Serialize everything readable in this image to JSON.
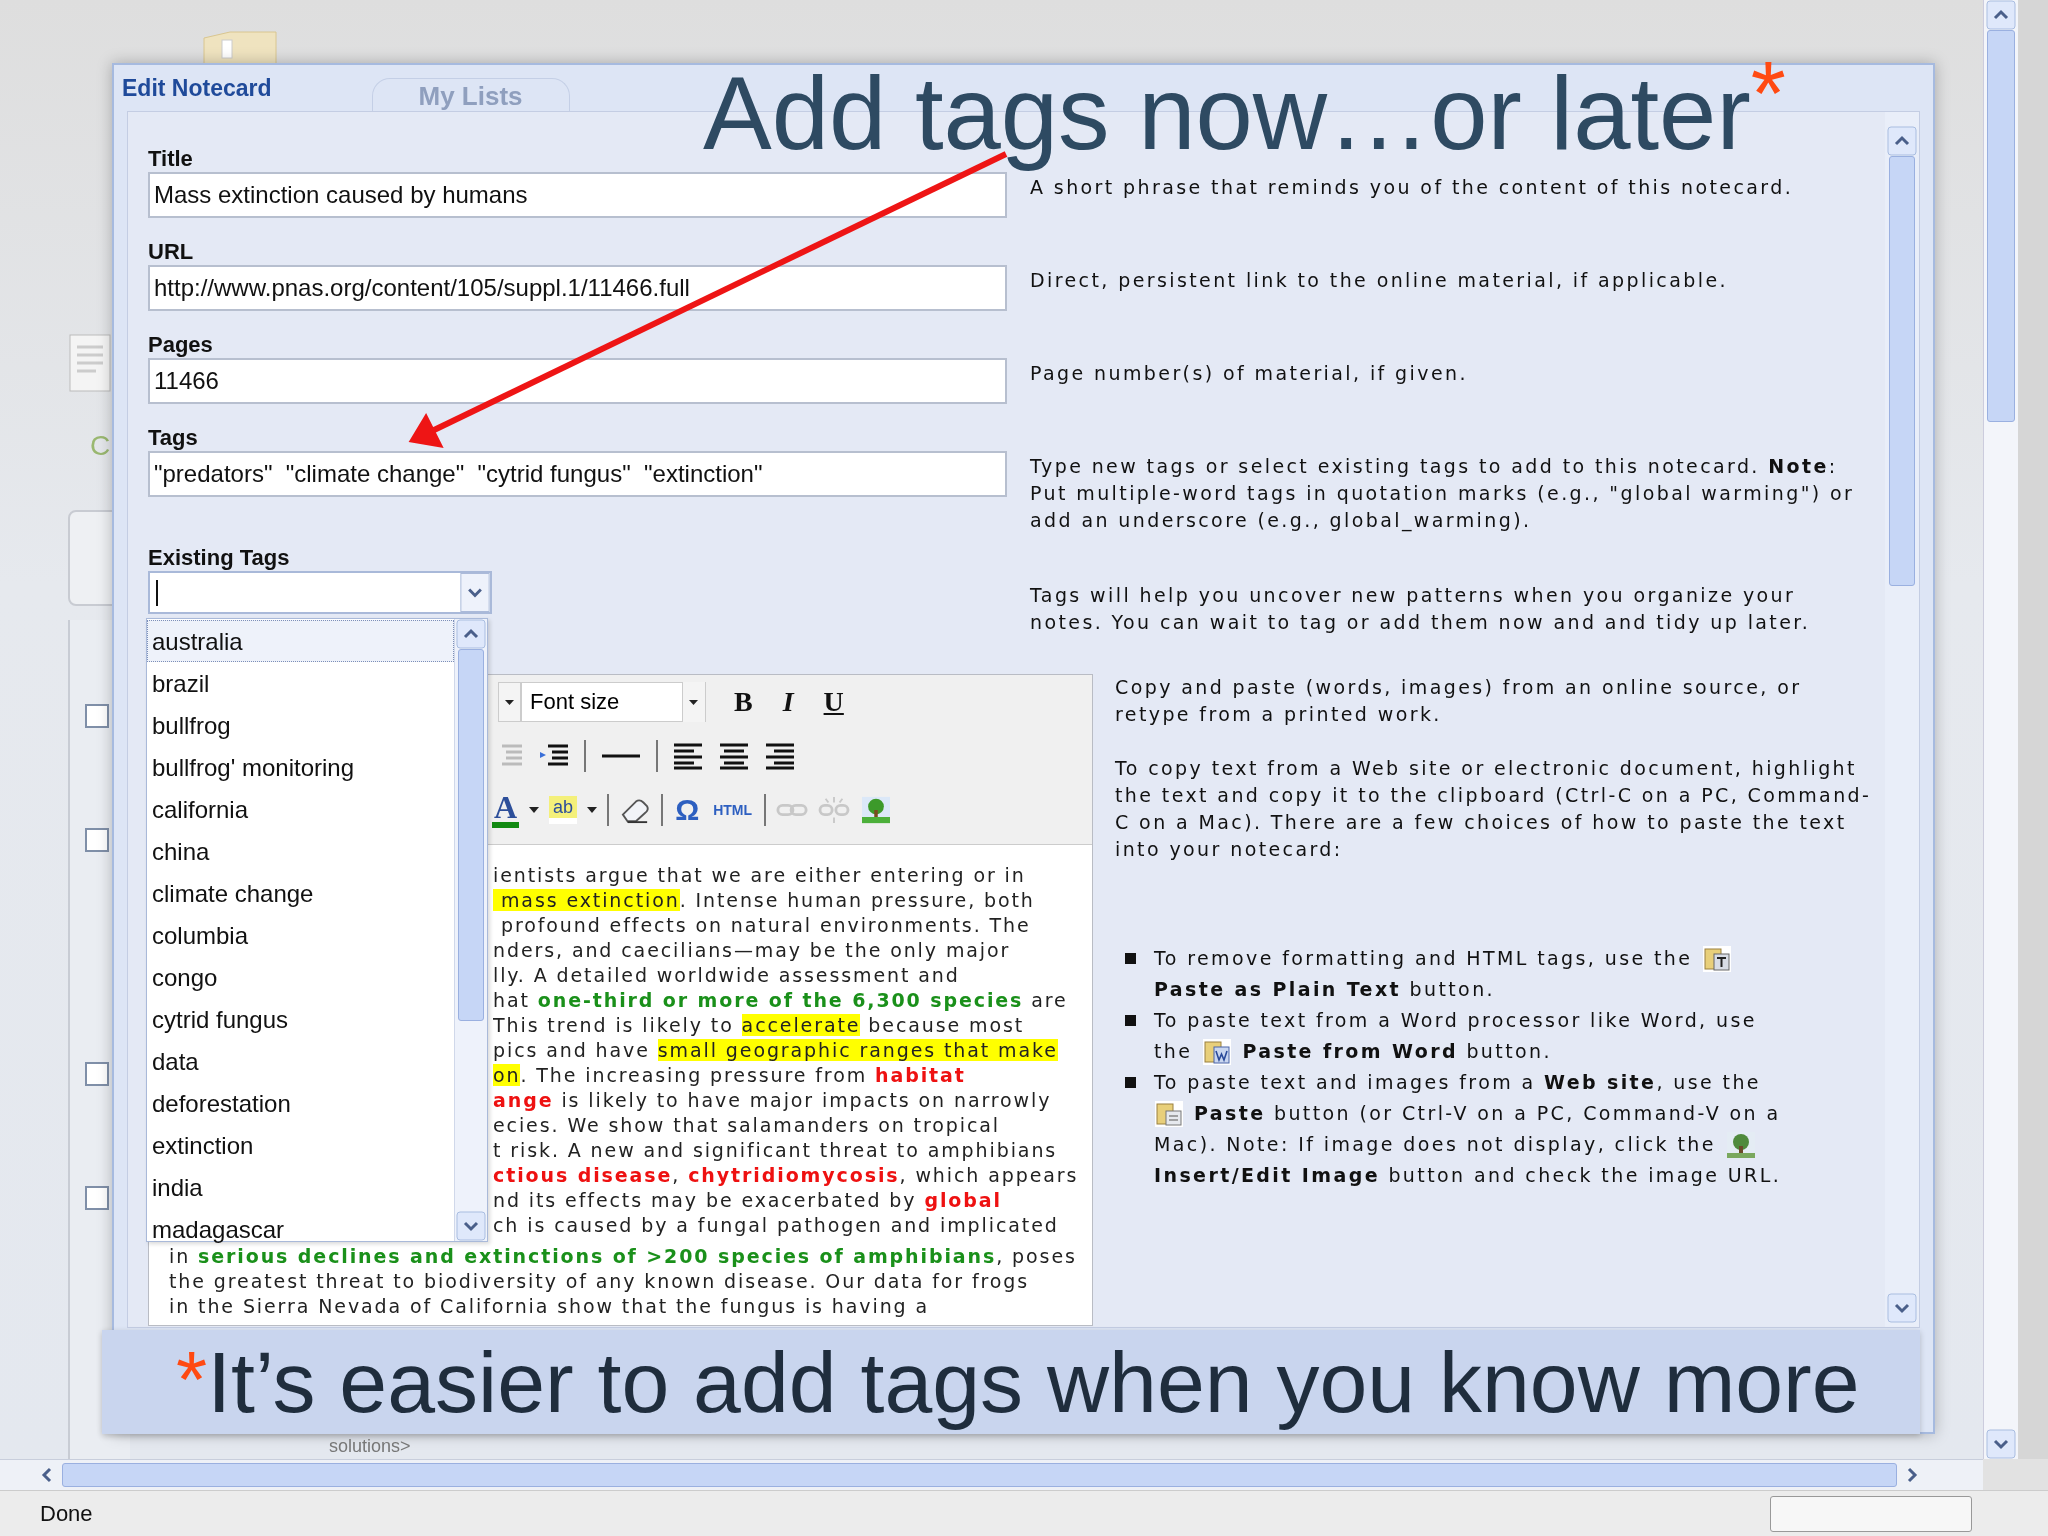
{
  "browser": {
    "status": "Done",
    "background": {
      "letter": "C",
      "footer_text": "solutions>",
      "checkboxes": [
        {
          "checked": false
        },
        {
          "checked": false
        },
        {
          "checked": false
        },
        {
          "checked": false
        }
      ]
    }
  },
  "annotation": {
    "text": "Add tags now…or later",
    "mark": "*"
  },
  "dialog": {
    "title": "Edit Notecard",
    "ghost_tab": "My Lists",
    "fields": [
      {
        "label": "Title",
        "value": "Mass extinction caused by humans",
        "help": "A short phrase that reminds you of the content of this notecard."
      },
      {
        "label": "URL",
        "value": "http://www.pnas.org/content/105/suppl.1/11466.full",
        "help": "Direct, persistent link to the online material, if applicable."
      },
      {
        "label": "Pages",
        "value": "11466",
        "help": "Page number(s) of material, if given."
      },
      {
        "label": "Tags",
        "value": "\"predators\"  \"climate change\"  \"cytrid fungus\"  \"extinction\"",
        "help": "Type new tags or select existing tags to add to this notecard. **Note**: Put multiple-word tags in quotation marks (e.g., \"global warming\") or add an underscore (e.g., global_warming)."
      }
    ],
    "existing_tags": {
      "label": "Existing Tags",
      "help": "Tags will help you uncover new patterns when you organize your notes. You can wait to tag or add them now and and tidy up later.",
      "options": [
        {
          "label": "australia",
          "selected": true
        },
        {
          "label": "brazil",
          "selected": false
        },
        {
          "label": "bullfrog",
          "selected": false
        },
        {
          "label": "bullfrog' monitoring",
          "selected": false
        },
        {
          "label": "california",
          "selected": false
        },
        {
          "label": "china",
          "selected": false
        },
        {
          "label": "climate change",
          "selected": false
        },
        {
          "label": "columbia",
          "selected": false
        },
        {
          "label": "congo",
          "selected": false
        },
        {
          "label": "cytrid fungus",
          "selected": false
        },
        {
          "label": "data",
          "selected": false
        },
        {
          "label": "deforestation",
          "selected": false
        },
        {
          "label": "extinction",
          "selected": false
        },
        {
          "label": "india",
          "selected": false
        },
        {
          "label": "madagascar",
          "selected": false
        }
      ]
    },
    "toolbar": {
      "font_size": "Font size",
      "format_buttons": [
        {
          "label": "B",
          "kind": "bold"
        },
        {
          "label": "I",
          "kind": "italic"
        },
        {
          "label": "U",
          "kind": "underline"
        }
      ],
      "text_color": "A",
      "highlight": "ab",
      "special_char": "Ω",
      "html": "HTML"
    },
    "editor": {
      "lines_beside_list": [
        [
          {
            "kind": "plain",
            "text": "ientists argue that we are either entering or in"
          }
        ],
        [
          {
            "kind": "highlight",
            "text": " mass extinction"
          },
          {
            "kind": "plain",
            "text": ". Intense human pressure, both"
          }
        ],
        [
          {
            "kind": "plain",
            "text": " profound effects on natural environments. The"
          }
        ],
        [
          {
            "kind": "plain",
            "text": "nders, and caecilians—may be the only major"
          }
        ],
        [
          {
            "kind": "plain",
            "text": "lly. A detailed worldwide assessment and"
          }
        ],
        [
          {
            "kind": "plain",
            "text": "hat "
          },
          {
            "kind": "green",
            "text": "one-third or more of the 6,300 species"
          },
          {
            "kind": "plain",
            "text": " are"
          }
        ],
        [
          {
            "kind": "plain",
            "text": "This trend is likely to "
          },
          {
            "kind": "highlight",
            "text": "accelerate"
          },
          {
            "kind": "plain",
            "text": " because most"
          }
        ],
        [
          {
            "kind": "plain",
            "text": "pics and have "
          },
          {
            "kind": "highlight",
            "text": "small geographic ranges that make"
          }
        ],
        [
          {
            "kind": "highlight",
            "text": "on"
          },
          {
            "kind": "plain",
            "text": ". The increasing pressure from "
          },
          {
            "kind": "red",
            "text": "habitat"
          }
        ],
        [
          {
            "kind": "red",
            "text": "ange"
          },
          {
            "kind": "plain",
            "text": " is likely to have major impacts on narrowly"
          }
        ],
        [
          {
            "kind": "plain",
            "text": "ecies. We show that salamanders on tropical"
          }
        ],
        [
          {
            "kind": "plain",
            "text": "t risk. A new and significant threat to amphibians"
          }
        ],
        [
          {
            "kind": "red",
            "text": "ctious disease"
          },
          {
            "kind": "plain",
            "text": ", "
          },
          {
            "kind": "red",
            "text": "chytridiomycosis"
          },
          {
            "kind": "plain",
            "text": ", which appears"
          }
        ],
        [
          {
            "kind": "plain",
            "text": "nd its effects may be exacerbated by "
          },
          {
            "kind": "red",
            "text": "global"
          }
        ],
        [
          {
            "kind": "plain",
            "text": "ch is caused by a fungal pathogen and implicated"
          }
        ]
      ],
      "lines_below_list": [
        [
          {
            "kind": "plain",
            "text": "in "
          },
          {
            "kind": "green",
            "text": "serious declines and extinctions of >200 species of amphibians"
          },
          {
            "kind": "plain",
            "text": ", poses"
          }
        ],
        [
          {
            "kind": "plain",
            "text": "the greatest threat to biodiversity of any known disease. Our data for frogs"
          }
        ],
        [
          {
            "kind": "plain",
            "text": "in the Sierra Nevada of California show that the fungus is having a"
          }
        ]
      ]
    },
    "editor_help": {
      "paragraphs": [
        "Copy and paste (words, images) from an online source, or retype from a printed work.",
        "To copy text from a Web site or electronic document, highlight the text and copy it to the clipboard (Ctrl-C on a PC, Command-C on a Mac). There are a few choices of how to paste the text into your notecard:"
      ],
      "bullets": [
        {
          "lines": [
            [
              {
                "kind": "text",
                "text": "To remove formatting and HTML tags, use the"
              },
              {
                "kind": "paste_text_button"
              }
            ],
            [
              {
                "kind": "text",
                "text": "**Paste as Plain Text** button."
              }
            ]
          ]
        },
        {
          "lines": [
            [
              {
                "kind": "text",
                "text": "To paste text from a Word processor like Word, use"
              }
            ],
            [
              {
                "kind": "text",
                "text": "the"
              },
              {
                "kind": "paste_word_button"
              },
              {
                "kind": "text",
                "text": "**Paste from Word** button."
              }
            ]
          ]
        },
        {
          "lines": [
            [
              {
                "kind": "text",
                "text": "To paste text and images from a **Web site**, use the"
              }
            ],
            [
              {
                "kind": "paste_button"
              },
              {
                "kind": "text",
                "text": "**Paste** button (or Ctrl-V on a PC, Command-V on a"
              }
            ],
            [
              {
                "kind": "text",
                "text": "Mac). Note: If image does not display, click the"
              },
              {
                "kind": "image_button"
              }
            ],
            [
              {
                "kind": "text",
                "text": "**Insert/Edit Image** button and check the image URL."
              }
            ]
          ]
        }
      ]
    }
  },
  "banner": {
    "mark": "*",
    "text": "It’s easier to add tags when you know more"
  }
}
